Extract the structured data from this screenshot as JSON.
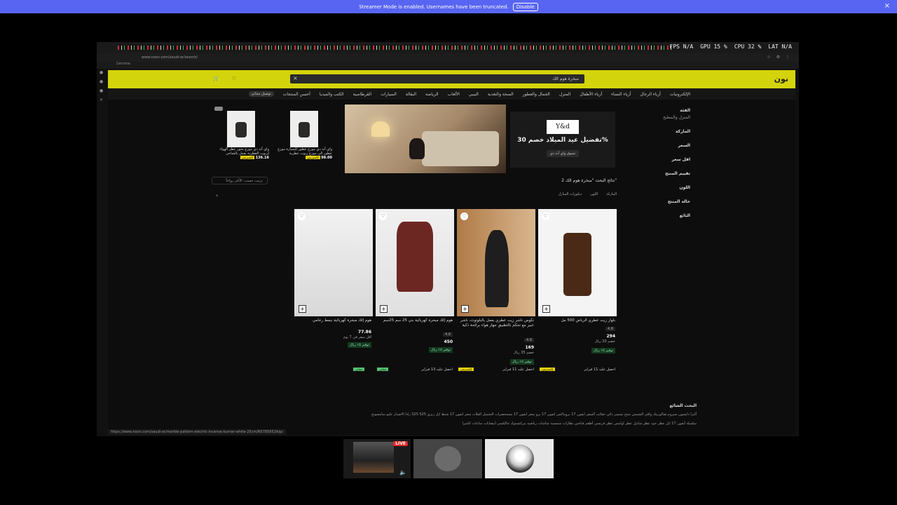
{
  "streamer_bar": {
    "message": "Streamer Mode is enabled. Usernames have been truncated.",
    "disable_label": "Disable",
    "close_glyph": "×",
    "color": "#5865f2"
  },
  "perf": {
    "fps": "FPS N/A",
    "gpu": "GPU 15 %",
    "cpu": "CPU 32 %",
    "lat": "LAT N/A"
  },
  "browser": {
    "url": "www.noon.com/saudi-ar/search/",
    "bookmark": "Gemma"
  },
  "noon": {
    "logo": "نون",
    "search_value": "مبخرة هوم الك",
    "nav": [
      "الإلكترونيات",
      "أزياء الرجال",
      "أزياء النساء",
      "أزياء الأطفال",
      "المنزل",
      "الجمال والعطور",
      "الصحة والتغذية",
      "البيبي",
      "الألعاب",
      "الرياضة",
      "البقالة",
      "السيارات",
      "القرطاسية",
      "الكتب والميديا",
      "أحسن المنتجات"
    ],
    "prime_label": "توصيل مجاني",
    "filters": [
      "الفئة",
      "الماركة",
      "السعر",
      "اقل سعر",
      "تقييم المنتج",
      "اللون",
      "حالة المنتج",
      "البائع"
    ],
    "filter_sub": "المنزل والمطبخ",
    "banner": {
      "brand": "Y&d",
      "headline": "تفضيل عيد الميلاد خصم 30%",
      "cta": "تسوق واي آند دي"
    },
    "mini_products": [
      {
        "title": "واي آند دي موزع عطور للسيارة موزع عطور الى موزع زيوت عطرية",
        "price": "98.00",
        "badge": "إكسبريس"
      },
      {
        "title": "واي آند دي موزع بخور عطر الهواء لزيوت العطرية يعمل بالشاحن",
        "price": "136.16",
        "badge": "إكسبريس"
      }
    ],
    "results_text": "2 نتائج البحث \"مبخرة هوم الك\"",
    "sort_label": "ترتيب حسب: الأكثر رواجاً",
    "chips": [
      "الماركة",
      "اللون",
      "ديكورات المنازل"
    ],
    "products": [
      {
        "title": "هوم إلك مبخرة كهربائية بنمط رخامي",
        "price": "77.86",
        "sub": "أقل سعر في 7 يوم",
        "deal": "توفير ١٥ ريال",
        "delivery": "",
        "badge": "مجاني",
        "badge_color": "#56c271"
      },
      {
        "title": "هوم إلك مبخرة كهربائية بني 25 سم 25سم",
        "rating": "4.8",
        "price": "450",
        "deal": "توفير ١٥ ريال",
        "delivery": "احصل عليه 13 فبراير",
        "badge": "مجاني",
        "badge_color": "#56c271"
      },
      {
        "title": "نكوس ناشر زيت عطري يعمل بالبلوتوث، ناشر عبير مع تحكم بالتطبيق جهاز هواء برائحة ذكية",
        "rating": "4.8",
        "price": "169",
        "sub": "خصم 35 ريال",
        "deal": "توفير ١٥ ريال",
        "delivery": "احصل عليه 11 فبراير",
        "badge": "إكسبريس",
        "badge_color": "#e6d10b"
      },
      {
        "title": "بلوار زيت عطري الرياض 500 مل",
        "rating": "4.8",
        "price": "294",
        "sub": "خصم 20 ريال",
        "deal": "توفير ١٥ ريال",
        "delivery": "احصل عليه 11 فبراير",
        "badge": "إكسبريس",
        "badge_color": "#e6d10b"
      }
    ],
    "popular_head": "البحث الشائع",
    "popular_line1": "رادا الاصدار  عليو  سامسونج S25  S25 ألترا  دايسون  سيروم هيالورنيك  واقي الشمس  منتج تسمير دائي  حقائب السفر  ايفون 17 بروماكس  ايفون 17 برو  سعر ايفون 17  مستحضرات التجميل  الفلات  سعر ايفون 17  شنط ابل  زيزي",
    "popular_line2": "سلسلة آيفون 17  ابل  عطر جود  عطر شانيل  عطر لوامس  عطر فرنسي  أطقم فناجين  نظارات شمسية  شاشات رياضية  بيركنستوك  جالكسي  أبيضايات  ساعات  كاميرا",
    "status_url": "https://www.noon.com/saudi-ar/marble-pattern-electric-incense-burner-white-25cm/N5785652A/p/"
  },
  "thumbs": {
    "live": "LIVE"
  }
}
